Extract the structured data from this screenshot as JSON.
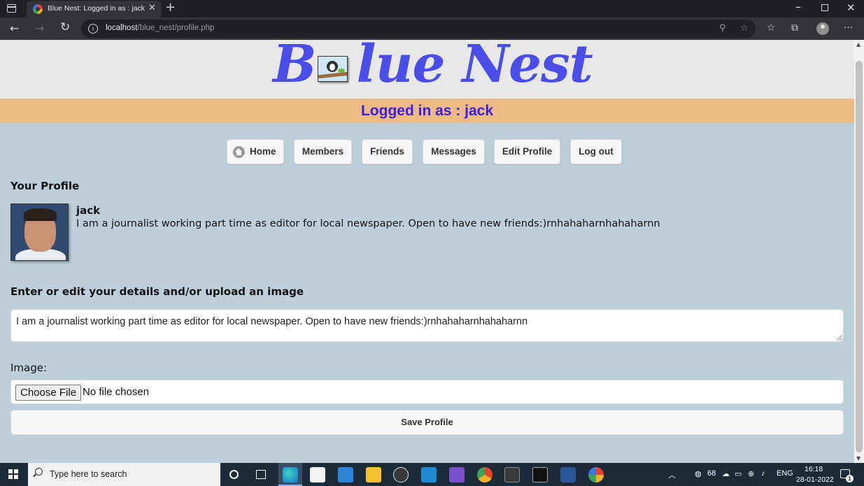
{
  "browser": {
    "tab_title": "Blue Nest: Logged in as : jack",
    "url_host": "localhost",
    "url_path": "/blue_nest/profile.php"
  },
  "site": {
    "logo_first": "B",
    "logo_rest": "lue Nest",
    "logged_in_text": "Logged in as : jack"
  },
  "nav": {
    "items": [
      {
        "label": "Home",
        "icon": "home-icon"
      },
      {
        "label": "Members"
      },
      {
        "label": "Friends"
      },
      {
        "label": "Messages"
      },
      {
        "label": "Edit Profile"
      },
      {
        "label": "Log out"
      }
    ]
  },
  "profile": {
    "section_title": "Your Profile",
    "name": "jack",
    "bio": "I am a journalist working part time as editor for local newspaper. Open to have new friends:)rnhahaharnhahaharnn"
  },
  "form": {
    "title": "Enter or edit your details and/or upload an image",
    "bio_value": "I am a journalist working part time as editor for local newspaper. Open to have new friends:)rnhahaharnhahaharnn",
    "image_label": "Image:",
    "choose_file_label": "Choose File",
    "file_status": "No file chosen",
    "save_label": "Save Profile"
  },
  "taskbar": {
    "search_placeholder": "Type here to search",
    "tray_number": "68",
    "language": "ENG",
    "time": "16:18",
    "date": "28-01-2022",
    "notification_count": "1"
  },
  "colors": {
    "logo": "#4a4de8",
    "logged_bar": "#edba86",
    "logged_text": "#3b1ee0",
    "page_bg": "#bdd0d9",
    "header_bg": "#e8e8e8"
  }
}
